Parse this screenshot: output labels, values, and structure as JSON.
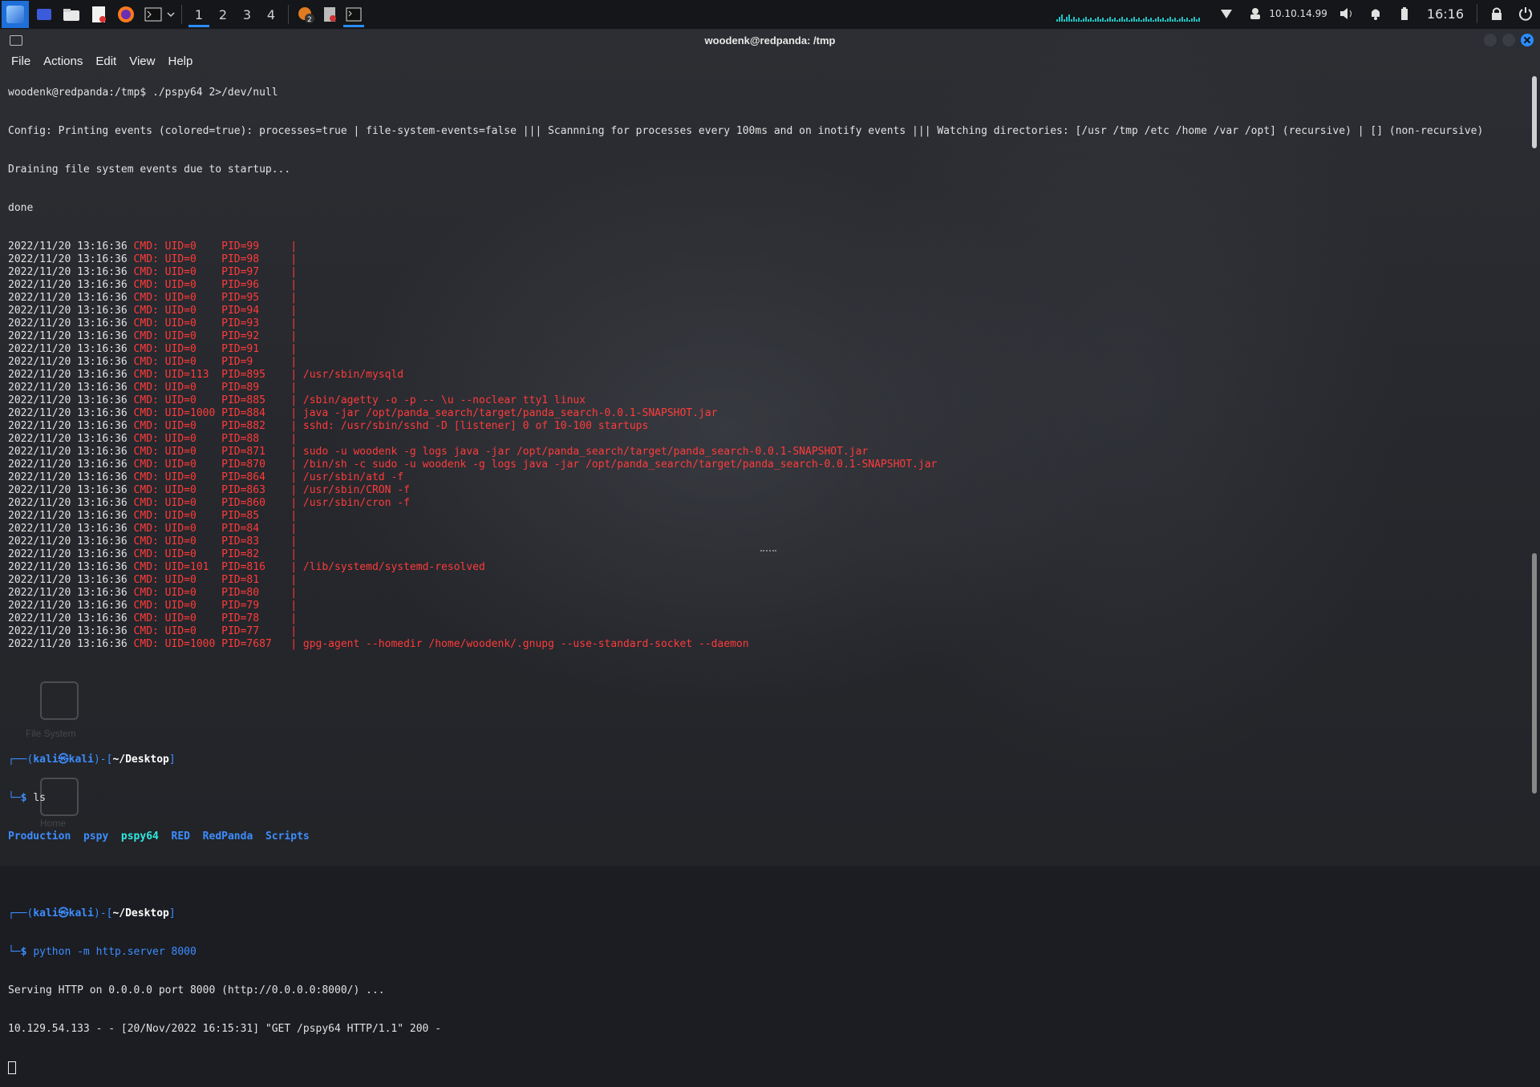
{
  "panel": {
    "workspaces": [
      "1",
      "2",
      "3",
      "4"
    ],
    "active_workspace": "1",
    "ip": "10.10.14.99",
    "clock": "16:16",
    "badge": "2"
  },
  "window": {
    "title": "woodenk@redpanda: /tmp",
    "menu": [
      "File",
      "Actions",
      "Edit",
      "View",
      "Help"
    ]
  },
  "pspy": {
    "prompt": "woodenk@redpanda:/tmp$ ./pspy64 2>/dev/null",
    "config": "Config: Printing events (colored=true): processes=true | file-system-events=false ||| Scannning for processes every 100ms and on inotify events ||| Watching directories: [/usr /tmp /etc /home /var /opt] (recursive) | [] (non-recursive)",
    "draining": "Draining file system events due to startup...",
    "done": "done",
    "events": [
      {
        "ts": "2022/11/20 13:16:36",
        "cmd": "CMD: UID=0    PID=99     | "
      },
      {
        "ts": "2022/11/20 13:16:36",
        "cmd": "CMD: UID=0    PID=98     | "
      },
      {
        "ts": "2022/11/20 13:16:36",
        "cmd": "CMD: UID=0    PID=97     | "
      },
      {
        "ts": "2022/11/20 13:16:36",
        "cmd": "CMD: UID=0    PID=96     | "
      },
      {
        "ts": "2022/11/20 13:16:36",
        "cmd": "CMD: UID=0    PID=95     | "
      },
      {
        "ts": "2022/11/20 13:16:36",
        "cmd": "CMD: UID=0    PID=94     | "
      },
      {
        "ts": "2022/11/20 13:16:36",
        "cmd": "CMD: UID=0    PID=93     | "
      },
      {
        "ts": "2022/11/20 13:16:36",
        "cmd": "CMD: UID=0    PID=92     | "
      },
      {
        "ts": "2022/11/20 13:16:36",
        "cmd": "CMD: UID=0    PID=91     | "
      },
      {
        "ts": "2022/11/20 13:16:36",
        "cmd": "CMD: UID=0    PID=9      | "
      },
      {
        "ts": "2022/11/20 13:16:36",
        "cmd": "CMD: UID=113  PID=895    | /usr/sbin/mysqld"
      },
      {
        "ts": "2022/11/20 13:16:36",
        "cmd": "CMD: UID=0    PID=89     | "
      },
      {
        "ts": "2022/11/20 13:16:36",
        "cmd": "CMD: UID=0    PID=885    | /sbin/agetty -o -p -- \\u --noclear tty1 linux"
      },
      {
        "ts": "2022/11/20 13:16:36",
        "cmd": "CMD: UID=1000 PID=884    | java -jar /opt/panda_search/target/panda_search-0.0.1-SNAPSHOT.jar"
      },
      {
        "ts": "2022/11/20 13:16:36",
        "cmd": "CMD: UID=0    PID=882    | sshd: /usr/sbin/sshd -D [listener] 0 of 10-100 startups"
      },
      {
        "ts": "2022/11/20 13:16:36",
        "cmd": "CMD: UID=0    PID=88     | "
      },
      {
        "ts": "2022/11/20 13:16:36",
        "cmd": "CMD: UID=0    PID=871    | sudo -u woodenk -g logs java -jar /opt/panda_search/target/panda_search-0.0.1-SNAPSHOT.jar"
      },
      {
        "ts": "2022/11/20 13:16:36",
        "cmd": "CMD: UID=0    PID=870    | /bin/sh -c sudo -u woodenk -g logs java -jar /opt/panda_search/target/panda_search-0.0.1-SNAPSHOT.jar"
      },
      {
        "ts": "2022/11/20 13:16:36",
        "cmd": "CMD: UID=0    PID=864    | /usr/sbin/atd -f"
      },
      {
        "ts": "2022/11/20 13:16:36",
        "cmd": "CMD: UID=0    PID=863    | /usr/sbin/CRON -f"
      },
      {
        "ts": "2022/11/20 13:16:36",
        "cmd": "CMD: UID=0    PID=860    | /usr/sbin/cron -f"
      },
      {
        "ts": "2022/11/20 13:16:36",
        "cmd": "CMD: UID=0    PID=85     | "
      },
      {
        "ts": "2022/11/20 13:16:36",
        "cmd": "CMD: UID=0    PID=84     | "
      },
      {
        "ts": "2022/11/20 13:16:36",
        "cmd": "CMD: UID=0    PID=83     | "
      },
      {
        "ts": "2022/11/20 13:16:36",
        "cmd": "CMD: UID=0    PID=82     | "
      },
      {
        "ts": "2022/11/20 13:16:36",
        "cmd": "CMD: UID=101  PID=816    | /lib/systemd/systemd-resolved"
      },
      {
        "ts": "2022/11/20 13:16:36",
        "cmd": "CMD: UID=0    PID=81     | "
      },
      {
        "ts": "2022/11/20 13:16:36",
        "cmd": "CMD: UID=0    PID=80     | "
      },
      {
        "ts": "2022/11/20 13:16:36",
        "cmd": "CMD: UID=0    PID=79     | "
      },
      {
        "ts": "2022/11/20 13:16:36",
        "cmd": "CMD: UID=0    PID=78     | "
      },
      {
        "ts": "2022/11/20 13:16:36",
        "cmd": "CMD: UID=0    PID=77     | "
      },
      {
        "ts": "2022/11/20 13:16:36",
        "cmd": "CMD: UID=1000 PID=7687   | gpg-agent --homedir /home/woodenk/.gnupg --use-standard-socket --daemon"
      }
    ]
  },
  "kali": {
    "prompt1_user": "kali",
    "prompt1_host": "kali",
    "prompt1_dir": "~/Desktop",
    "cmd1": "ls",
    "ls": [
      {
        "name": "Production",
        "kind": "dir"
      },
      {
        "name": "pspy",
        "kind": "dir"
      },
      {
        "name": "pspy64",
        "kind": "exec"
      },
      {
        "name": "RED",
        "kind": "dir"
      },
      {
        "name": "RedPanda",
        "kind": "dir"
      },
      {
        "name": "Scripts",
        "kind": "dir"
      }
    ],
    "prompt2_dir": "~/Desktop",
    "cmd2": "python -m http.server 8000",
    "out1": "Serving HTTP on 0.0.0.0 port 8000 (http://0.0.0.0:8000/) ...",
    "out2": "10.129.54.133 - - [20/Nov/2022 16:15:31] \"GET /pspy64 HTTP/1.1\" 200 -"
  },
  "desktop": {
    "labels": [
      "File System",
      "Home"
    ]
  },
  "colors": {
    "accent": "#2a8cff",
    "pspy_red": "#ff3b3b",
    "prompt_blue": "#3d8dff",
    "exec_cyan": "#2ee8e0"
  }
}
